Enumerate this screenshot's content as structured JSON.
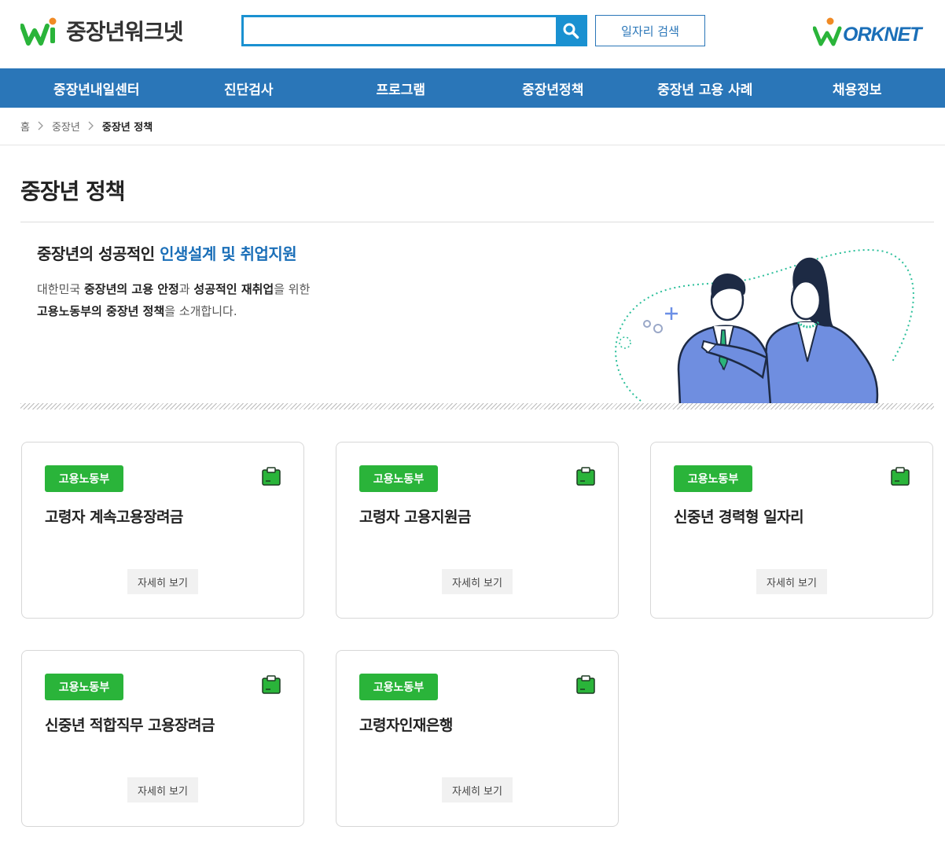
{
  "header": {
    "logo_text": "중장년워크넷",
    "search": {
      "value": "",
      "placeholder": ""
    },
    "job_search_label": "일자리 검색",
    "worknet_logo_text": "ORKNET"
  },
  "nav": {
    "items": [
      {
        "label": "중장년내일센터"
      },
      {
        "label": "진단검사"
      },
      {
        "label": "프로그램"
      },
      {
        "label": "중장년정책"
      },
      {
        "label": "중장년 고용 사례"
      },
      {
        "label": "채용정보"
      }
    ]
  },
  "breadcrumb": {
    "items": [
      {
        "label": "홈"
      },
      {
        "label": "중장년"
      },
      {
        "label": "중장년 정책"
      }
    ]
  },
  "page": {
    "title": "중장년 정책",
    "intro": {
      "heading_prefix": "중장년의 성공적인 ",
      "heading_highlight": "인생설계 및 취업지원",
      "desc_line1_a": "대한민국 ",
      "desc_line1_b": "중장년의 고용 안정",
      "desc_line1_c": "과 ",
      "desc_line1_d": "성공적인 재취업",
      "desc_line1_e": "을 위한",
      "desc_line2_a": "고용노동부의 중장년 정책",
      "desc_line2_b": "을 소개합니다."
    }
  },
  "cards": [
    {
      "badge": "고용노동부",
      "title": "고령자 계속고용장려금",
      "button": "자세히 보기"
    },
    {
      "badge": "고용노동부",
      "title": "고령자 고용지원금",
      "button": "자세히 보기"
    },
    {
      "badge": "고용노동부",
      "title": "신중년 경력형 일자리",
      "button": "자세히 보기"
    },
    {
      "badge": "고용노동부",
      "title": "신중년 적합직무 고용장려금",
      "button": "자세히 보기"
    },
    {
      "badge": "고용노동부",
      "title": "고령자인재은행",
      "button": "자세히 보기"
    }
  ],
  "colors": {
    "primary_blue": "#2a76b8",
    "search_blue": "#1a91d1",
    "badge_green": "#2ab43a",
    "logo_orange": "#f08a24"
  },
  "icons": {
    "search": "search-icon",
    "clip": "clipboard-icon",
    "breadcrumb_sep": "chevron-right-icon"
  }
}
